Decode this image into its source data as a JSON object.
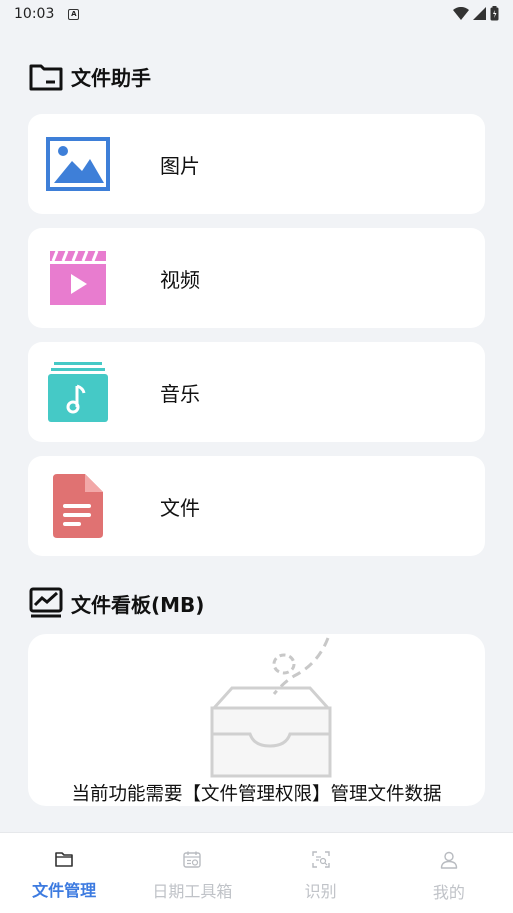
{
  "status_bar": {
    "time": "10:03",
    "notif_glyph": "A"
  },
  "files_section": {
    "title": "文件助手",
    "items": [
      {
        "label": "图片",
        "icon": "image-icon",
        "color": "#3e7fd8"
      },
      {
        "label": "视频",
        "icon": "video-icon",
        "color": "#e87ccf"
      },
      {
        "label": "音乐",
        "icon": "music-icon",
        "color": "#45c9c6"
      },
      {
        "label": "文件",
        "icon": "document-icon",
        "color": "#e07272"
      }
    ]
  },
  "board_section": {
    "title": "文件看板(MB)",
    "empty_message": "当前功能需要【文件管理权限】管理文件数据"
  },
  "tabbar": {
    "items": [
      {
        "label": "文件管理",
        "icon": "folder-icon",
        "active": true
      },
      {
        "label": "日期工具箱",
        "icon": "calendar-icon",
        "active": false
      },
      {
        "label": "识别",
        "icon": "scan-icon",
        "active": false
      },
      {
        "label": "我的",
        "icon": "user-icon",
        "active": false
      }
    ]
  },
  "colors": {
    "accent": "#3d7be0",
    "background": "#f1f3f6",
    "card": "#ffffff",
    "inactive": "#c0c3c8"
  }
}
